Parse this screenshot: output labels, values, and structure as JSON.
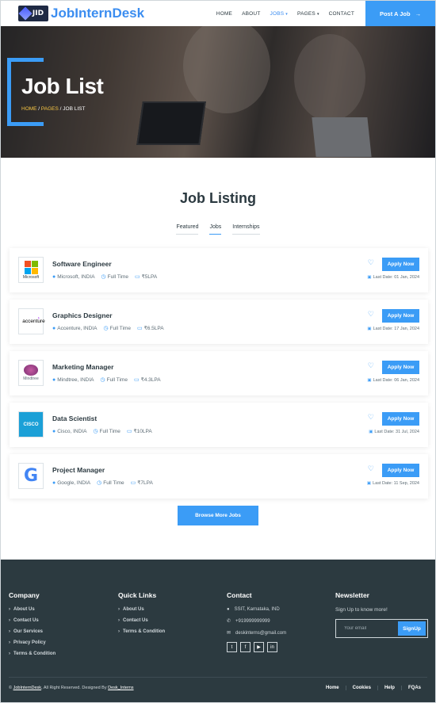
{
  "nav": {
    "logo_text": "JID",
    "brand": "JobInternDesk",
    "items": [
      {
        "label": "HOME",
        "active": false,
        "dropdown": false
      },
      {
        "label": "ABOUT",
        "active": false,
        "dropdown": false
      },
      {
        "label": "JOBS",
        "active": true,
        "dropdown": true
      },
      {
        "label": "PAGES",
        "active": false,
        "dropdown": true
      },
      {
        "label": "CONTACT",
        "active": false,
        "dropdown": false
      }
    ],
    "cta": "Post A Job"
  },
  "hero": {
    "title": "Job List",
    "crumbs": [
      "HOME",
      "PAGES",
      "JOB LIST"
    ]
  },
  "listing": {
    "title": "Job Listing",
    "tabs": [
      "Featured",
      "Jobs",
      "Internships"
    ],
    "active_tab": "Jobs",
    "jobs": [
      {
        "title": "Software Engineer",
        "company": "Microsoft, INDIA",
        "type": "Full Time",
        "salary": "₹5LPA",
        "apply": "Apply Now",
        "deadline": "Last Date: 01 Jan, 2024",
        "logo": "Microsoft"
      },
      {
        "title": "Graphics Designer",
        "company": "Accenture, INDIA",
        "type": "Full Time",
        "salary": "₹6.5LPA",
        "apply": "Apply Now",
        "deadline": "Last Date: 17 Jan, 2024",
        "logo": "accenture"
      },
      {
        "title": "Marketing Manager",
        "company": "Mindtree, INDIA",
        "type": "Full Time",
        "salary": "₹4.3LPA",
        "apply": "Apply Now",
        "deadline": "Last Date: 06 Jan, 2024",
        "logo": "Mindtree"
      },
      {
        "title": "Data Scientist",
        "company": "Cisco, INDIA",
        "type": "Full Time",
        "salary": "₹10LPA",
        "apply": "Apply Now",
        "deadline": "Last Date: 31 Jul, 2024",
        "logo": "CISCO"
      },
      {
        "title": "Project Manager",
        "company": "Google, INDIA",
        "type": "Full Time",
        "salary": "₹7LPA",
        "apply": "Apply Now",
        "deadline": "Last Date: 11 Sep, 2024",
        "logo": "G"
      }
    ],
    "browse": "Browse More Jobs"
  },
  "footer": {
    "company": {
      "title": "Company",
      "links": [
        "About Us",
        "Contact Us",
        "Our Services",
        "Privacy Policy",
        "Terms & Condition"
      ]
    },
    "quick": {
      "title": "Quick Links",
      "links": [
        "About Us",
        "Contact Us",
        "Terms & Condition"
      ]
    },
    "contact": {
      "title": "Contact",
      "address": "SSIT, Karnataka, IND",
      "phone": "+919999999999",
      "email": "deskinterns@gmail.com"
    },
    "newsletter": {
      "title": "Newsletter",
      "text": "Sign Up to know more!",
      "placeholder": "Your email",
      "button": "SignUp"
    },
    "copyright_brand": "JobInternDesk",
    "copyright_text": ", All Right Reserved. Designed By ",
    "designer": "Desk_Interns",
    "bottom_links": [
      "Home",
      "Cookies",
      "Help",
      "FQAs"
    ]
  },
  "colors": {
    "accent": "#3b9cf6",
    "footer_bg": "#2c3a40",
    "highlight": "#f6c543"
  }
}
